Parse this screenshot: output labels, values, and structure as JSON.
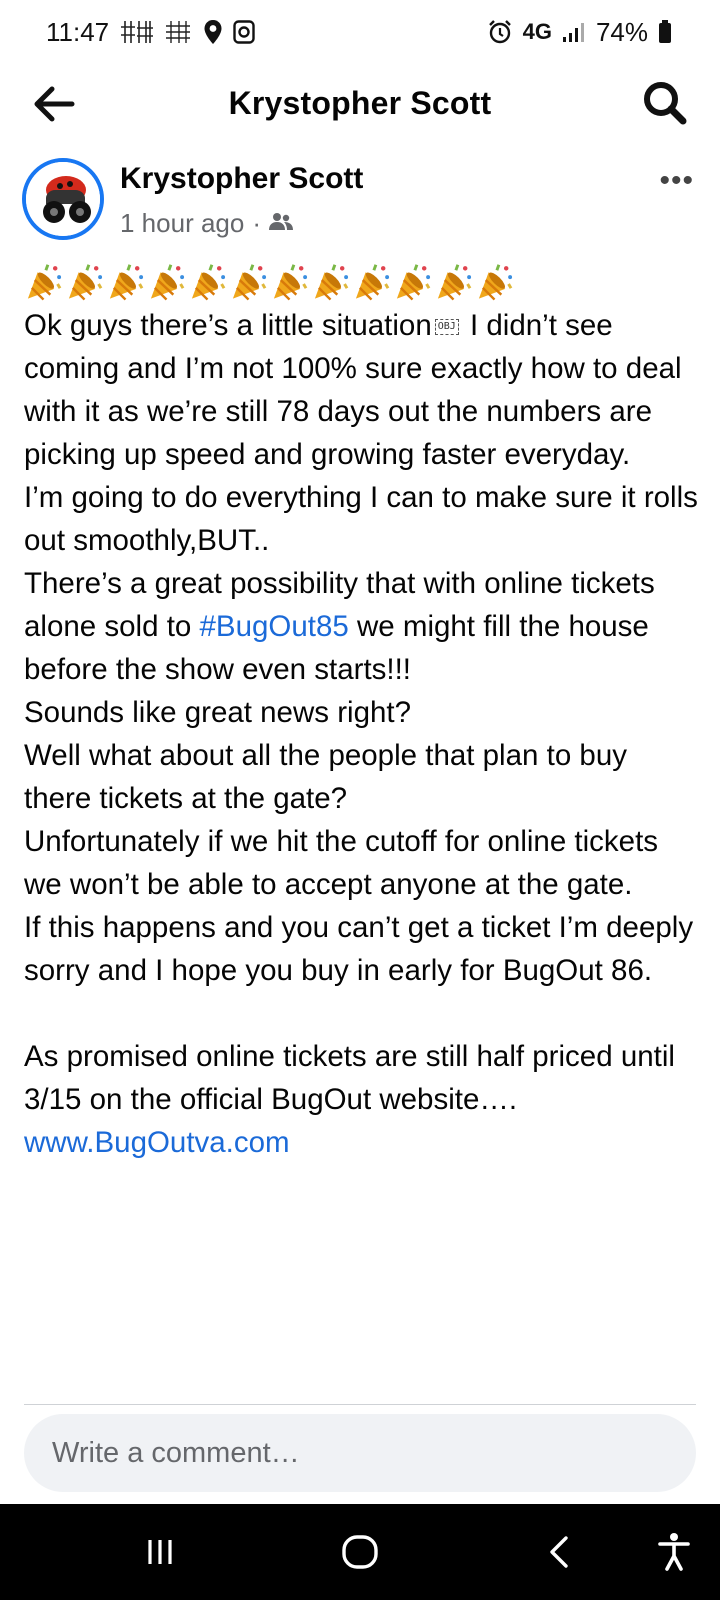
{
  "status_bar": {
    "time": "11:47",
    "network": "4G",
    "battery": "74%"
  },
  "header": {
    "title": "Krystopher Scott"
  },
  "post": {
    "author": "Krystopher Scott",
    "time_ago": "1 hour ago",
    "separator": "·",
    "obj_placeholder": "OBJ",
    "emoji_count": 12,
    "text": {
      "line1_before": "Ok guys there’s a little situation",
      "line1_after": " I didn’t see coming and I’m not 100% sure exactly how to deal with it as we’re still 78 days out the numbers are picking up speed and growing faster everyday.",
      "para2": "I’m going to do everything I can to make sure it rolls out smoothly,BUT..",
      "para3_before": "There’s a great possibility that with online tickets alone sold to ",
      "hashtag": "#BugOut85",
      "para3_after": " we might fill the house before the show even starts!!!",
      "para4": "Sounds like great news right?",
      "para5": "Well what about all the people that plan to buy there tickets at the gate?",
      "para6": "Unfortunately if we hit the cutoff for online tickets we won’t be able to accept anyone at the gate.",
      "para7": "If this happens and you can’t get a ticket I’m deeply sorry and I hope you buy in early for BugOut 86.",
      "para8": "As promised online tickets are still half priced until 3/15 on the official BugOut website….",
      "link": "www.BugOutva.com"
    }
  },
  "comment": {
    "placeholder": "Write a comment…"
  },
  "colors": {
    "link": "#1b6ad8",
    "avatar_ring": "#1877f2",
    "muted_text": "#65676b",
    "comment_bg": "#f0f2f5"
  },
  "icons": {
    "back": "arrow-left-icon",
    "search": "search-icon",
    "more": "more-dots-icon",
    "audience": "friends-audience-icon",
    "emoji": "party-popper-icon"
  }
}
